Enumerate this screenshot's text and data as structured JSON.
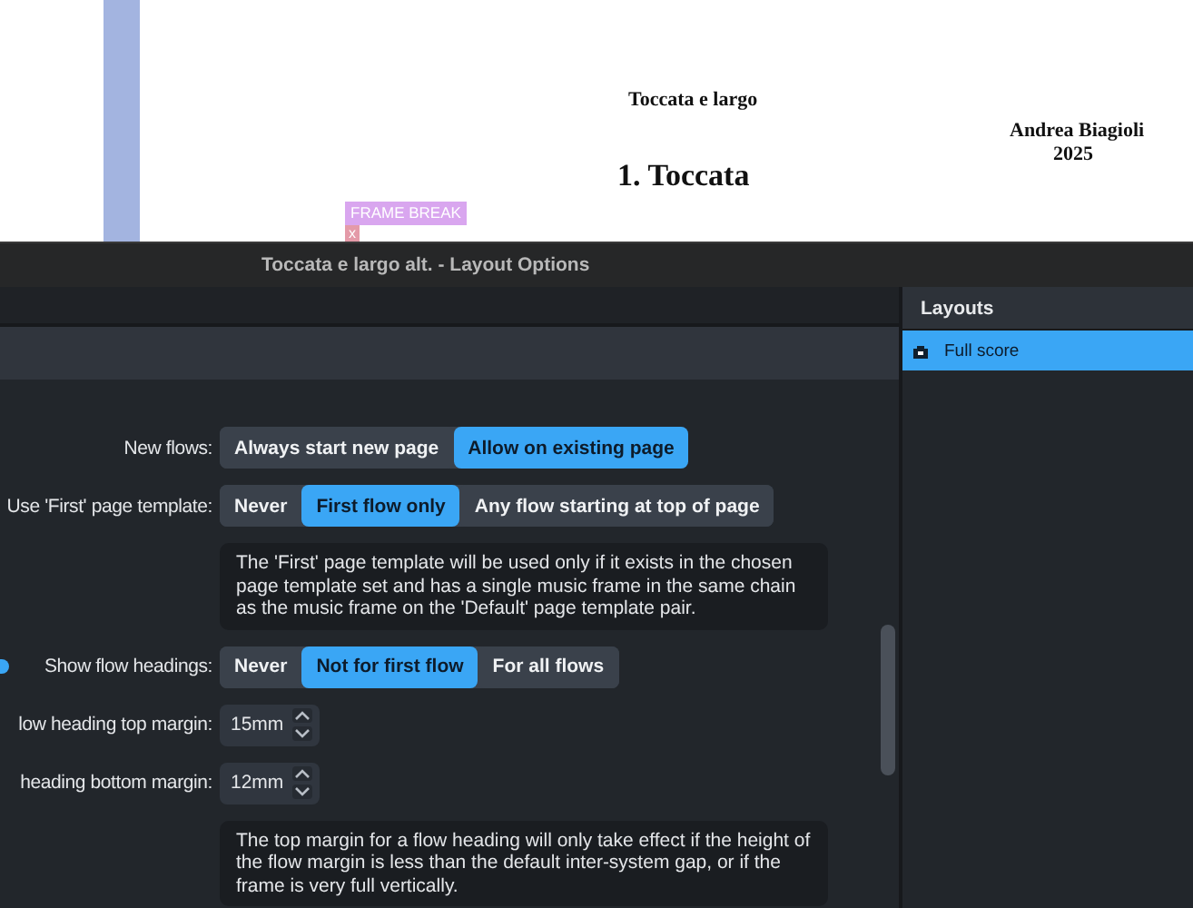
{
  "score": {
    "title": "Toccata e largo",
    "flow_title": "1. Toccata",
    "composer": "Andrea Biagioli",
    "year": "2025",
    "frame_break": "FRAME BREAK",
    "break_marker": "x"
  },
  "dialog": {
    "title": "Toccata e largo alt. - Layout Options",
    "options": [
      {
        "kind": "segmented",
        "label": "New flows:",
        "choices": [
          {
            "label": "Always start new page",
            "selected": false
          },
          {
            "label": "Allow on existing page",
            "selected": true
          }
        ]
      },
      {
        "kind": "segmented",
        "label": "Use 'First' page template:",
        "choices": [
          {
            "label": "Never",
            "selected": false
          },
          {
            "label": "First flow only",
            "selected": true
          },
          {
            "label": "Any flow starting at top of page",
            "selected": false
          }
        ]
      },
      {
        "kind": "note",
        "text": "The 'First' page template will be used only if it exists in the chosen page template set and has a single music frame in the same chain as the music frame on the 'Default' page template pair."
      },
      {
        "kind": "segmented",
        "label": "Show flow headings:",
        "marker": true,
        "choices": [
          {
            "label": "Never",
            "selected": false
          },
          {
            "label": "Not for first flow",
            "selected": true
          },
          {
            "label": "For all flows",
            "selected": false
          }
        ]
      },
      {
        "kind": "spinner",
        "label": "low heading top margin:",
        "value": "15mm"
      },
      {
        "kind": "spinner",
        "label": "heading bottom margin:",
        "value": "12mm"
      },
      {
        "kind": "note",
        "text": "The top margin for a flow heading will only take effect if the height of the flow margin is less than the default inter-system gap, or if the frame is very full vertically."
      }
    ]
  },
  "layouts_panel": {
    "title": "Layouts",
    "items": [
      {
        "label": "Full score",
        "selected": true
      }
    ]
  }
}
